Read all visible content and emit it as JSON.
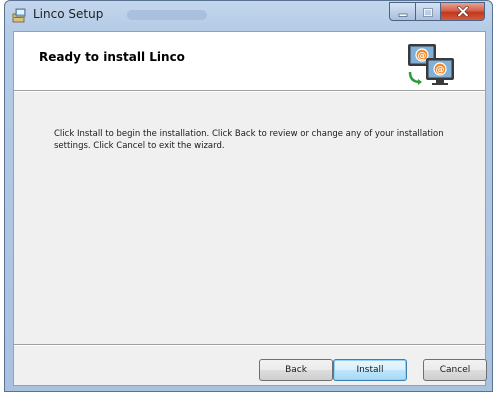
{
  "window": {
    "title": "Linco Setup"
  },
  "banner": {
    "title": "Ready to install Linco"
  },
  "body": {
    "message": "Click Install to begin the installation. Click Back to review or change any of your installation settings. Click Cancel to exit the wizard."
  },
  "buttons": {
    "back": "Back",
    "install": "Install",
    "cancel": "Cancel"
  },
  "icons": {
    "app": "installer-package-icon",
    "banner": "computer-email-icon",
    "minimize": "minimize-icon",
    "maximize": "maximize-icon",
    "close": "close-icon"
  },
  "colors": {
    "titlebar": "#b4cbe6",
    "close_button": "#c3371d",
    "default_button_border": "#3c7fb1"
  }
}
